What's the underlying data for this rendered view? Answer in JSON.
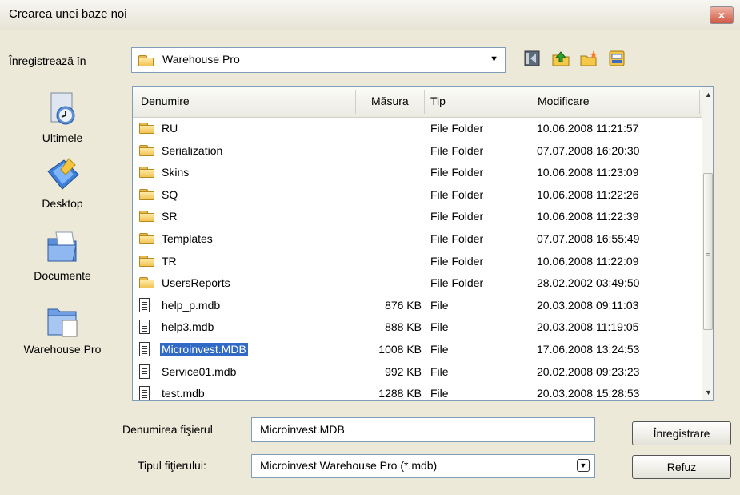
{
  "window": {
    "title": "Crearea unei baze noi",
    "close_label": "×"
  },
  "save_in": {
    "label": "Înregistrează în",
    "value": "Warehouse Pro"
  },
  "toolbar": {
    "back": "back-icon",
    "up": "up-folder-icon",
    "new_folder": "new-folder-icon",
    "view": "view-menu-icon"
  },
  "places": [
    {
      "label": "Ultimele",
      "icon": "recent-icon"
    },
    {
      "label": "Desktop",
      "icon": "desktop-icon"
    },
    {
      "label": "Documente",
      "icon": "documents-icon"
    },
    {
      "label": "Warehouse Pro",
      "icon": "warehouse-folder-icon"
    }
  ],
  "columns": {
    "name": "Denumire",
    "size": "Măsura",
    "type": "Tip",
    "modified": "Modificare"
  },
  "files": [
    {
      "name": "RU",
      "size": "",
      "type": "File Folder",
      "modified": "10.06.2008 11:21:57",
      "kind": "folder"
    },
    {
      "name": "Serialization",
      "size": "",
      "type": "File Folder",
      "modified": "07.07.2008 16:20:30",
      "kind": "folder"
    },
    {
      "name": "Skins",
      "size": "",
      "type": "File Folder",
      "modified": "10.06.2008 11:23:09",
      "kind": "folder"
    },
    {
      "name": "SQ",
      "size": "",
      "type": "File Folder",
      "modified": "10.06.2008 11:22:26",
      "kind": "folder"
    },
    {
      "name": "SR",
      "size": "",
      "type": "File Folder",
      "modified": "10.06.2008 11:22:39",
      "kind": "folder"
    },
    {
      "name": "Templates",
      "size": "",
      "type": "File Folder",
      "modified": "07.07.2008 16:55:49",
      "kind": "folder"
    },
    {
      "name": "TR",
      "size": "",
      "type": "File Folder",
      "modified": "10.06.2008 11:22:09",
      "kind": "folder"
    },
    {
      "name": "UsersReports",
      "size": "",
      "type": "File Folder",
      "modified": "28.02.2002 03:49:50",
      "kind": "folder"
    },
    {
      "name": "help_p.mdb",
      "size": "876 KB",
      "type": "File",
      "modified": "20.03.2008 09:11:03",
      "kind": "file"
    },
    {
      "name": "help3.mdb",
      "size": "888 KB",
      "type": "File",
      "modified": "20.03.2008 11:19:05",
      "kind": "file"
    },
    {
      "name": "Microinvest.MDB",
      "size": "1008 KB",
      "type": "File",
      "modified": "17.06.2008 13:24:53",
      "kind": "file",
      "selected": true
    },
    {
      "name": "Service01.mdb",
      "size": "992 KB",
      "type": "File",
      "modified": "20.02.2008 09:23:23",
      "kind": "file"
    },
    {
      "name": "test.mdb",
      "size": "1288 KB",
      "type": "File",
      "modified": "20.03.2008 15:28:53",
      "kind": "file"
    }
  ],
  "filename": {
    "label": "Denumirea fişierul",
    "value": "Microinvest.MDB"
  },
  "filetype": {
    "label": "Tipul fiţierului:",
    "value": "Microinvest Warehouse Pro (*.mdb)"
  },
  "buttons": {
    "save": "Înregistrare",
    "cancel": "Refuz"
  }
}
